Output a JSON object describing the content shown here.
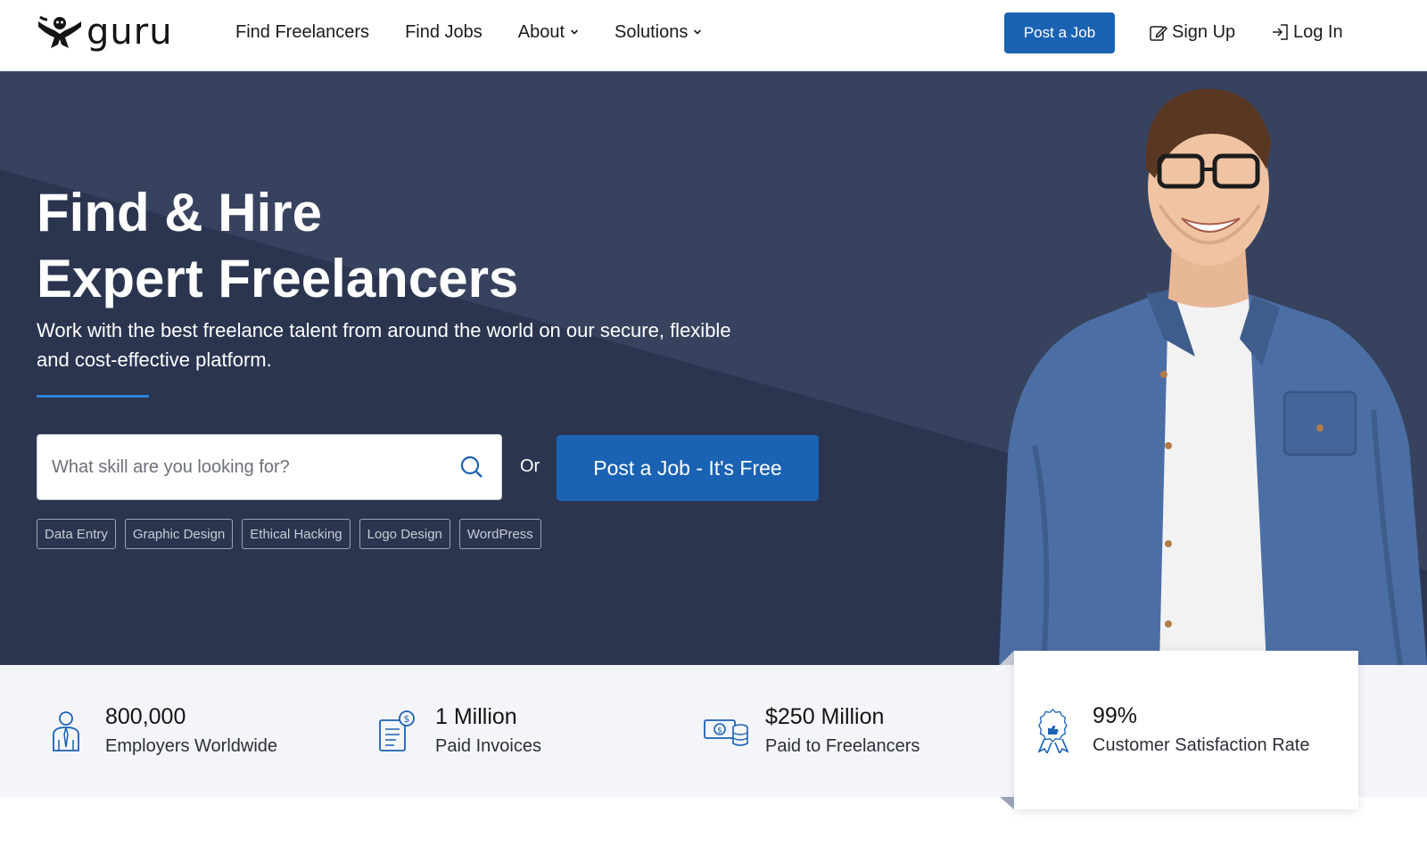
{
  "brand": {
    "logo_text": "guru"
  },
  "nav": {
    "links": [
      {
        "label": "Find Freelancers"
      },
      {
        "label": "Find Jobs"
      },
      {
        "label": "About"
      },
      {
        "label": "Solutions"
      }
    ],
    "post_job": "Post a Job",
    "sign_up": "Sign Up",
    "log_in": "Log In"
  },
  "hero": {
    "title_line1": "Find & Hire",
    "title_line2": "Expert Freelancers",
    "subtitle": "Work with the best freelance talent from around the world on our secure, flexible and cost-effective platform.",
    "search_placeholder": "What skill are you looking for?",
    "or_label": "Or",
    "cta": "Post a Job - It's Free",
    "tags": [
      "Data Entry",
      "Graphic Design",
      "Ethical Hacking",
      "Logo Design",
      "WordPress"
    ]
  },
  "stats": [
    {
      "value": "800,000",
      "label": "Employers Worldwide",
      "icon": "employer-icon"
    },
    {
      "value": "1 Million",
      "label": "Paid Invoices",
      "icon": "invoice-icon"
    },
    {
      "value": "$250 Million",
      "label": "Paid to Freelancers",
      "icon": "money-icon"
    },
    {
      "value": "99%",
      "label": "Customer Satisfaction Rate",
      "icon": "award-icon"
    }
  ],
  "colors": {
    "primary": "#1a62b3",
    "hero_bg": "#323d57",
    "accent_line": "#2f7fd6",
    "stats_bg": "#f4f5f9"
  }
}
